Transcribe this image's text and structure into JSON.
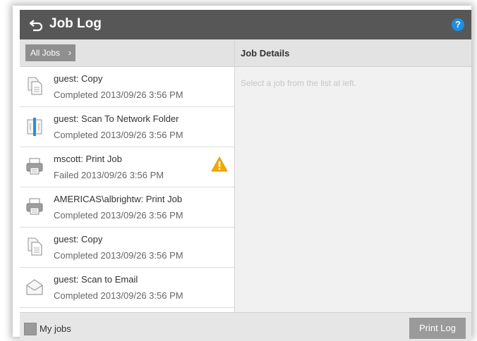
{
  "header": {
    "title": "Job Log",
    "back_icon": "back-arrow-icon",
    "help_icon": "help-icon",
    "help_glyph": "?",
    "accent_color": "#1c8fe0"
  },
  "left": {
    "filter_label": "All Jobs",
    "filter_chevron": "›",
    "jobs": [
      {
        "title": "guest: Copy",
        "status": "Completed 2013/09/26 3:56 PM",
        "icon": "copy-icon",
        "warning": false
      },
      {
        "title": "guest: Scan To Network Folder",
        "status": "Completed 2013/09/26 3:56 PM",
        "icon": "scan-folder-icon",
        "warning": false
      },
      {
        "title": "mscott: Print Job",
        "status": "Failed 2013/09/26 3:56 PM",
        "icon": "printer-icon",
        "warning": true
      },
      {
        "title": "AMERICAS\\albrightw: Print Job",
        "status": "Completed 2013/09/26 3:56 PM",
        "icon": "printer-icon",
        "warning": false
      },
      {
        "title": "guest: Copy",
        "status": "Completed 2013/09/26 3:56 PM",
        "icon": "copy-icon",
        "warning": false
      },
      {
        "title": "guest: Scan to Email",
        "status": "Completed 2013/09/26 3:56 PM",
        "icon": "email-icon",
        "warning": false
      }
    ]
  },
  "right": {
    "title": "Job Details",
    "placeholder": "Select a job from the list at left."
  },
  "footer": {
    "my_jobs_label": "My jobs",
    "my_jobs_checked": false,
    "print_log_label": "Print Log"
  },
  "colors": {
    "titlebar": "#575757",
    "warning": "#f5a800"
  }
}
